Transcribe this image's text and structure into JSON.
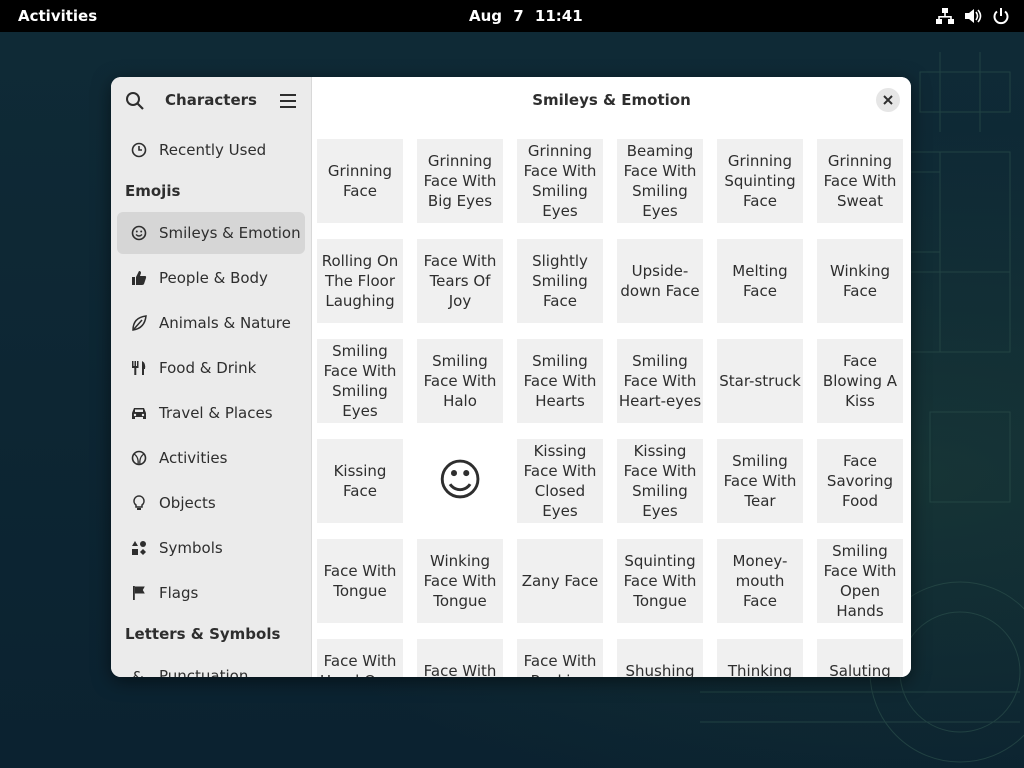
{
  "topbar": {
    "activities": "Activities",
    "clock": "Aug 7  11:41",
    "tray_icons": [
      "network-icon",
      "volume-icon",
      "power-icon"
    ]
  },
  "window": {
    "sidebar_title": "Characters",
    "main_title": "Smileys & Emotion",
    "recently_used": "Recently Used",
    "emojis_header": "Emojis",
    "letters_header": "Letters & Symbols",
    "categories": [
      {
        "label": "Smileys & Emotion",
        "icon": "smiley-icon",
        "active": true
      },
      {
        "label": "People & Body",
        "icon": "thumbs-up-icon"
      },
      {
        "label": "Animals & Nature",
        "icon": "leaf-icon"
      },
      {
        "label": "Food & Drink",
        "icon": "fork-knife-icon"
      },
      {
        "label": "Travel & Places",
        "icon": "car-icon"
      },
      {
        "label": "Activities",
        "icon": "ball-icon"
      },
      {
        "label": "Objects",
        "icon": "lightbulb-icon"
      },
      {
        "label": "Symbols",
        "icon": "symbols-icon"
      },
      {
        "label": "Flags",
        "icon": "flag-icon"
      }
    ],
    "letters_first_item": "Punctuation",
    "grid": [
      [
        "Grinning Face",
        "Grinning Face With Big Eyes",
        "Grinning Face With Smiling Eyes",
        "Beaming Face With Smiling Eyes",
        "Grinning Squinting Face",
        "Grinning Face With Sweat"
      ],
      [
        "Rolling On The Floor Laughing",
        "Face With Tears Of Joy",
        "Slightly Smiling Face",
        "Upside-down Face",
        "Melting Face",
        "Winking Face"
      ],
      [
        "Smiling Face With Smiling Eyes",
        "Smiling Face With Halo",
        "Smiling Face With Hearts",
        "Smiling Face With Heart-eyes",
        "Star-struck",
        "Face Blowing A Kiss"
      ],
      [
        "Kissing Face",
        "☺",
        "Kissing Face With Closed Eyes",
        "Kissing Face With Smiling Eyes",
        "Smiling Face With Tear",
        "Face Savoring Food"
      ],
      [
        "Face With Tongue",
        "Winking Face With Tongue",
        "Zany Face",
        "Squinting Face With Tongue",
        "Money-mouth Face",
        "Smiling Face With Open Hands"
      ],
      [
        "Face With Hand Over Mouth",
        "Face With Open Eyes",
        "Face With Peeking Eye",
        "Shushing Face",
        "Thinking Face",
        "Saluting Face"
      ]
    ]
  }
}
